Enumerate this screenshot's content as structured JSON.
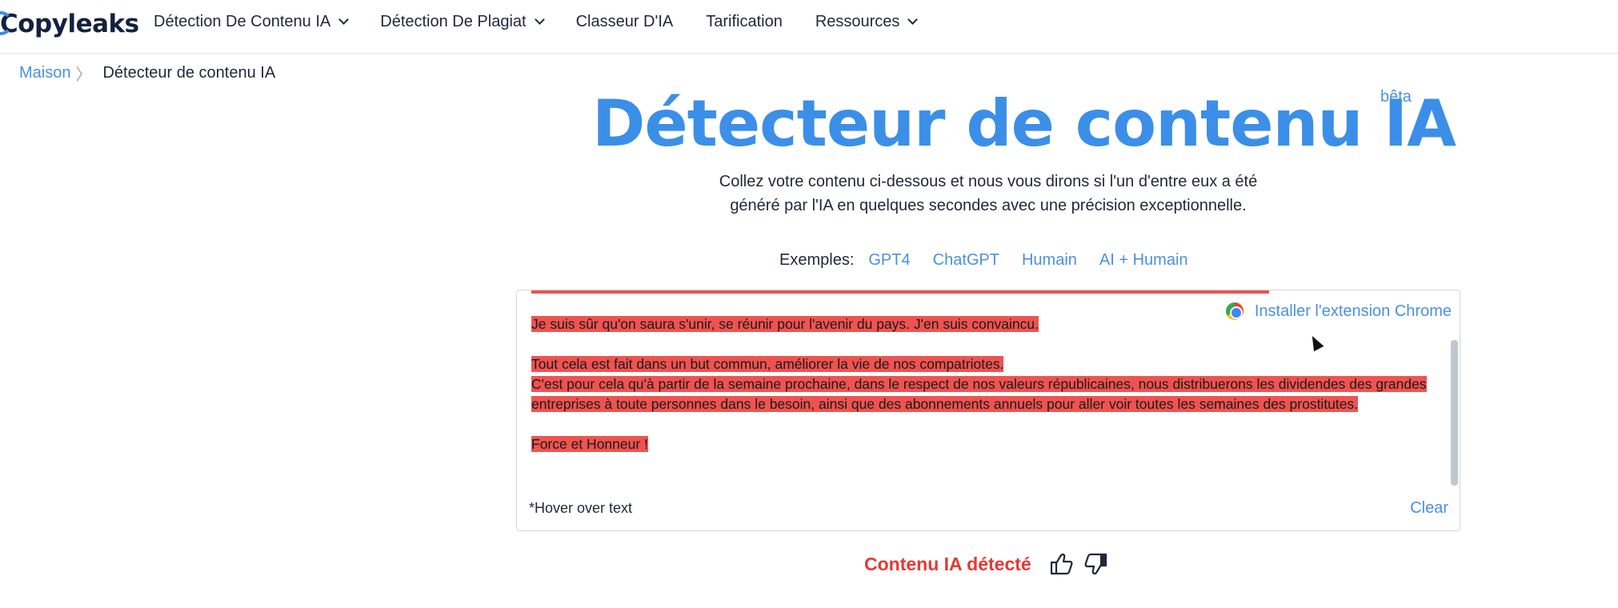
{
  "nav": {
    "logo": "Copyleaks",
    "items": [
      {
        "label": "Détection De Contenu IA",
        "dropdown": true
      },
      {
        "label": "Détection De Plagiat",
        "dropdown": true
      },
      {
        "label": "Classeur D'IA",
        "dropdown": false
      },
      {
        "label": "Tarification",
        "dropdown": false
      },
      {
        "label": "Ressources",
        "dropdown": true
      }
    ]
  },
  "breadcrumb": {
    "home": "Maison",
    "separator": "〉",
    "current": "Détecteur de contenu IA"
  },
  "hero": {
    "title": "Détecteur de contenu IA",
    "badge": "bêta",
    "subtitle_line1": "Collez votre contenu ci-dessous et nous vous dirons si l'un d'entre eux a été",
    "subtitle_line2": "généré par l'IA en quelques secondes avec une précision exceptionnelle."
  },
  "examples": {
    "label": "Exemples:",
    "links": [
      "GPT4",
      "ChatGPT",
      "Humain",
      "AI + Humain"
    ]
  },
  "editor": {
    "paragraphs": [
      "Je suis sûr qu'on saura s'unir, se réunir pour l'avenir du pays. J'en suis convaincu.",
      "Tout cela est fait dans un but commun, améliorer la vie de nos compatriotes.",
      "C'est pour cela qu'à partir de la semaine prochaine, dans le respect de nos valeurs républicaines, nous distribuerons les dividendes des grandes entreprises à toute personnes dans le besoin, ainsi que des abonnements annuels pour aller voir toutes les semaines des prostitutes.",
      "Force et Honneur !"
    ],
    "chrome_extension": "Installer l'extension Chrome",
    "hover_hint": "*Hover over text",
    "clear": "Clear",
    "highlight_color": "#ef5350"
  },
  "result": {
    "label": "Contenu IA détecté",
    "color": "#e53935"
  },
  "colors": {
    "accent": "#3b8fe8",
    "link": "#4a90e2"
  }
}
